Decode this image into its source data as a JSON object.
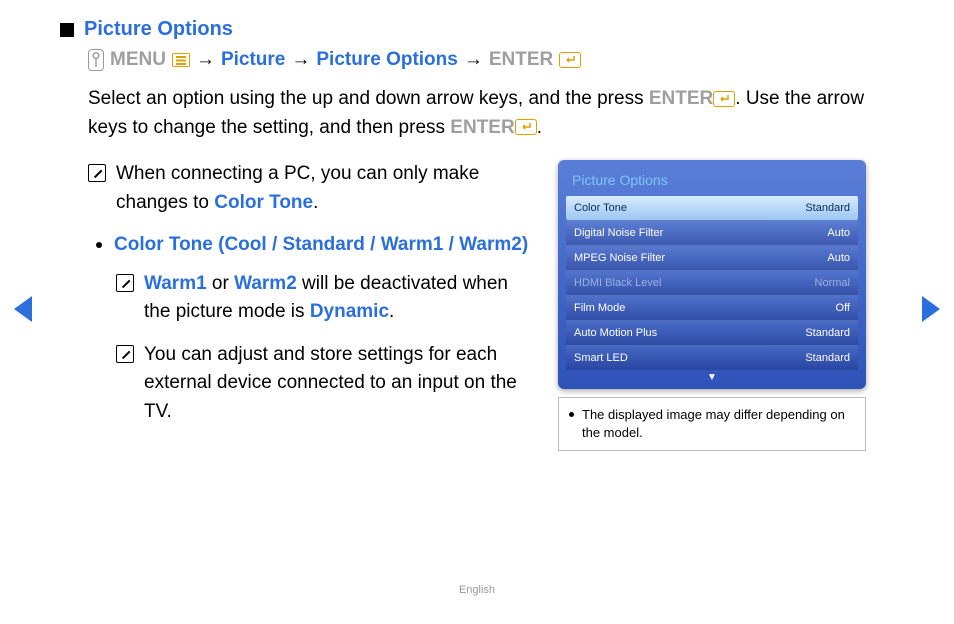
{
  "title": "Picture Options",
  "breadcrumb": {
    "menu": "MENU",
    "arrow": "→",
    "picture": "Picture",
    "picture_options": "Picture Options",
    "enter": "ENTER"
  },
  "instructions": {
    "line1a": "Select an option using the up and down arrow keys, and the press ",
    "line1_enter": "ENTER",
    "line1b": ". Use the arrow keys to change the setting, and then press ",
    "line1_enter2": "ENTER",
    "line1c": "."
  },
  "note_pc_a": "When connecting a PC, you can only make changes to ",
  "note_pc_b": "Color Tone",
  "note_pc_c": ".",
  "color_tone_heading": "Color Tone (Cool / Standard / Warm1 / Warm2)",
  "warm_note": {
    "a": "Warm1",
    "b": " or ",
    "c": "Warm2",
    "d": " will be deactivated when the picture mode is ",
    "e": "Dynamic",
    "f": "."
  },
  "adjust_note": "You can adjust and store settings for each external device connected to an input on the TV.",
  "osd": {
    "title": "Picture Options",
    "rows": [
      {
        "label": "Color Tone",
        "value": "Standard",
        "state": "selected"
      },
      {
        "label": "Digital Noise Filter",
        "value": "Auto",
        "state": ""
      },
      {
        "label": "MPEG Noise Filter",
        "value": "Auto",
        "state": ""
      },
      {
        "label": "HDMI Black Level",
        "value": "Normal",
        "state": "disabled"
      },
      {
        "label": "Film Mode",
        "value": "Off",
        "state": ""
      },
      {
        "label": "Auto Motion Plus",
        "value": "Standard",
        "state": ""
      },
      {
        "label": "Smart LED",
        "value": "Standard",
        "state": ""
      }
    ],
    "scroll": "▼"
  },
  "caption": "The displayed image may differ depending on the model.",
  "footer": "English"
}
